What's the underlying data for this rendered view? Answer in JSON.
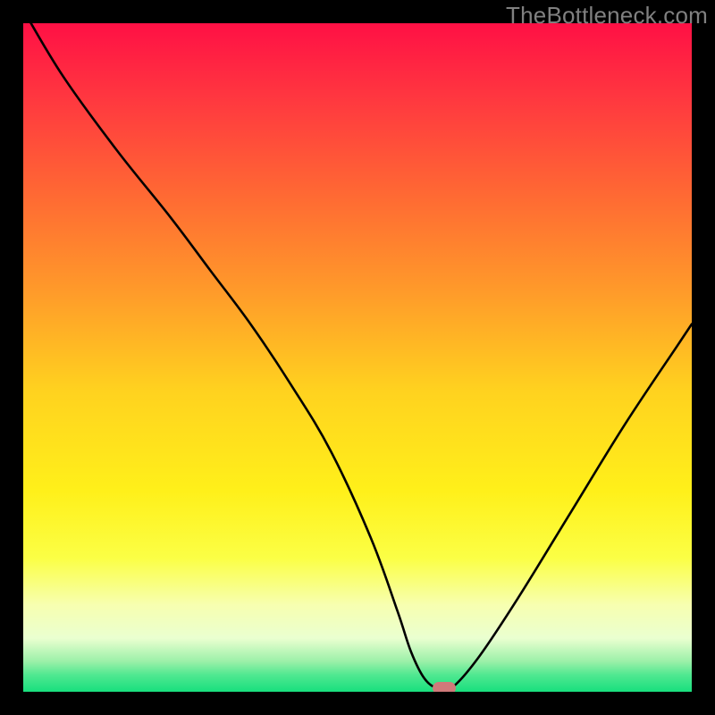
{
  "watermark": "TheBottleneck.com",
  "colors": {
    "frame_bg": "#000000",
    "curve": "#000000",
    "marker": "#cf7a7a",
    "watermark_text": "#808080",
    "gradient_stops": [
      {
        "offset": 0.0,
        "color": "#ff1045"
      },
      {
        "offset": 0.12,
        "color": "#ff3a3f"
      },
      {
        "offset": 0.26,
        "color": "#ff6a33"
      },
      {
        "offset": 0.4,
        "color": "#ff9a2a"
      },
      {
        "offset": 0.55,
        "color": "#ffd21f"
      },
      {
        "offset": 0.7,
        "color": "#fff01a"
      },
      {
        "offset": 0.8,
        "color": "#fbff45"
      },
      {
        "offset": 0.87,
        "color": "#f7ffb0"
      },
      {
        "offset": 0.92,
        "color": "#eaffd0"
      },
      {
        "offset": 0.955,
        "color": "#9af0a8"
      },
      {
        "offset": 0.975,
        "color": "#4fe890"
      },
      {
        "offset": 1.0,
        "color": "#18df7e"
      }
    ]
  },
  "chart_data": {
    "type": "line",
    "title": "",
    "xlabel": "",
    "ylabel": "",
    "xlim": [
      0,
      100
    ],
    "ylim": [
      0,
      100
    ],
    "legend": false,
    "grid": false,
    "series": [
      {
        "name": "bottleneck-curve",
        "x": [
          0,
          6,
          14,
          22,
          28,
          34,
          40,
          46,
          52,
          56,
          58,
          60,
          62,
          64,
          68,
          74,
          82,
          90,
          98,
          100
        ],
        "y": [
          102,
          92,
          81,
          71,
          63,
          55,
          46,
          36,
          23,
          12,
          6,
          2,
          0.5,
          0.5,
          5,
          14,
          27,
          40,
          52,
          55
        ]
      }
    ],
    "marker": {
      "x": 63,
      "y": 0.5
    },
    "notes": "y is plotted with 0 at the bottom (green) and 100 at the top (red). Curve descends from upper-left, bottoms out near x≈62, rises to the right. Values estimated from pixels; no axes/ticks visible."
  }
}
